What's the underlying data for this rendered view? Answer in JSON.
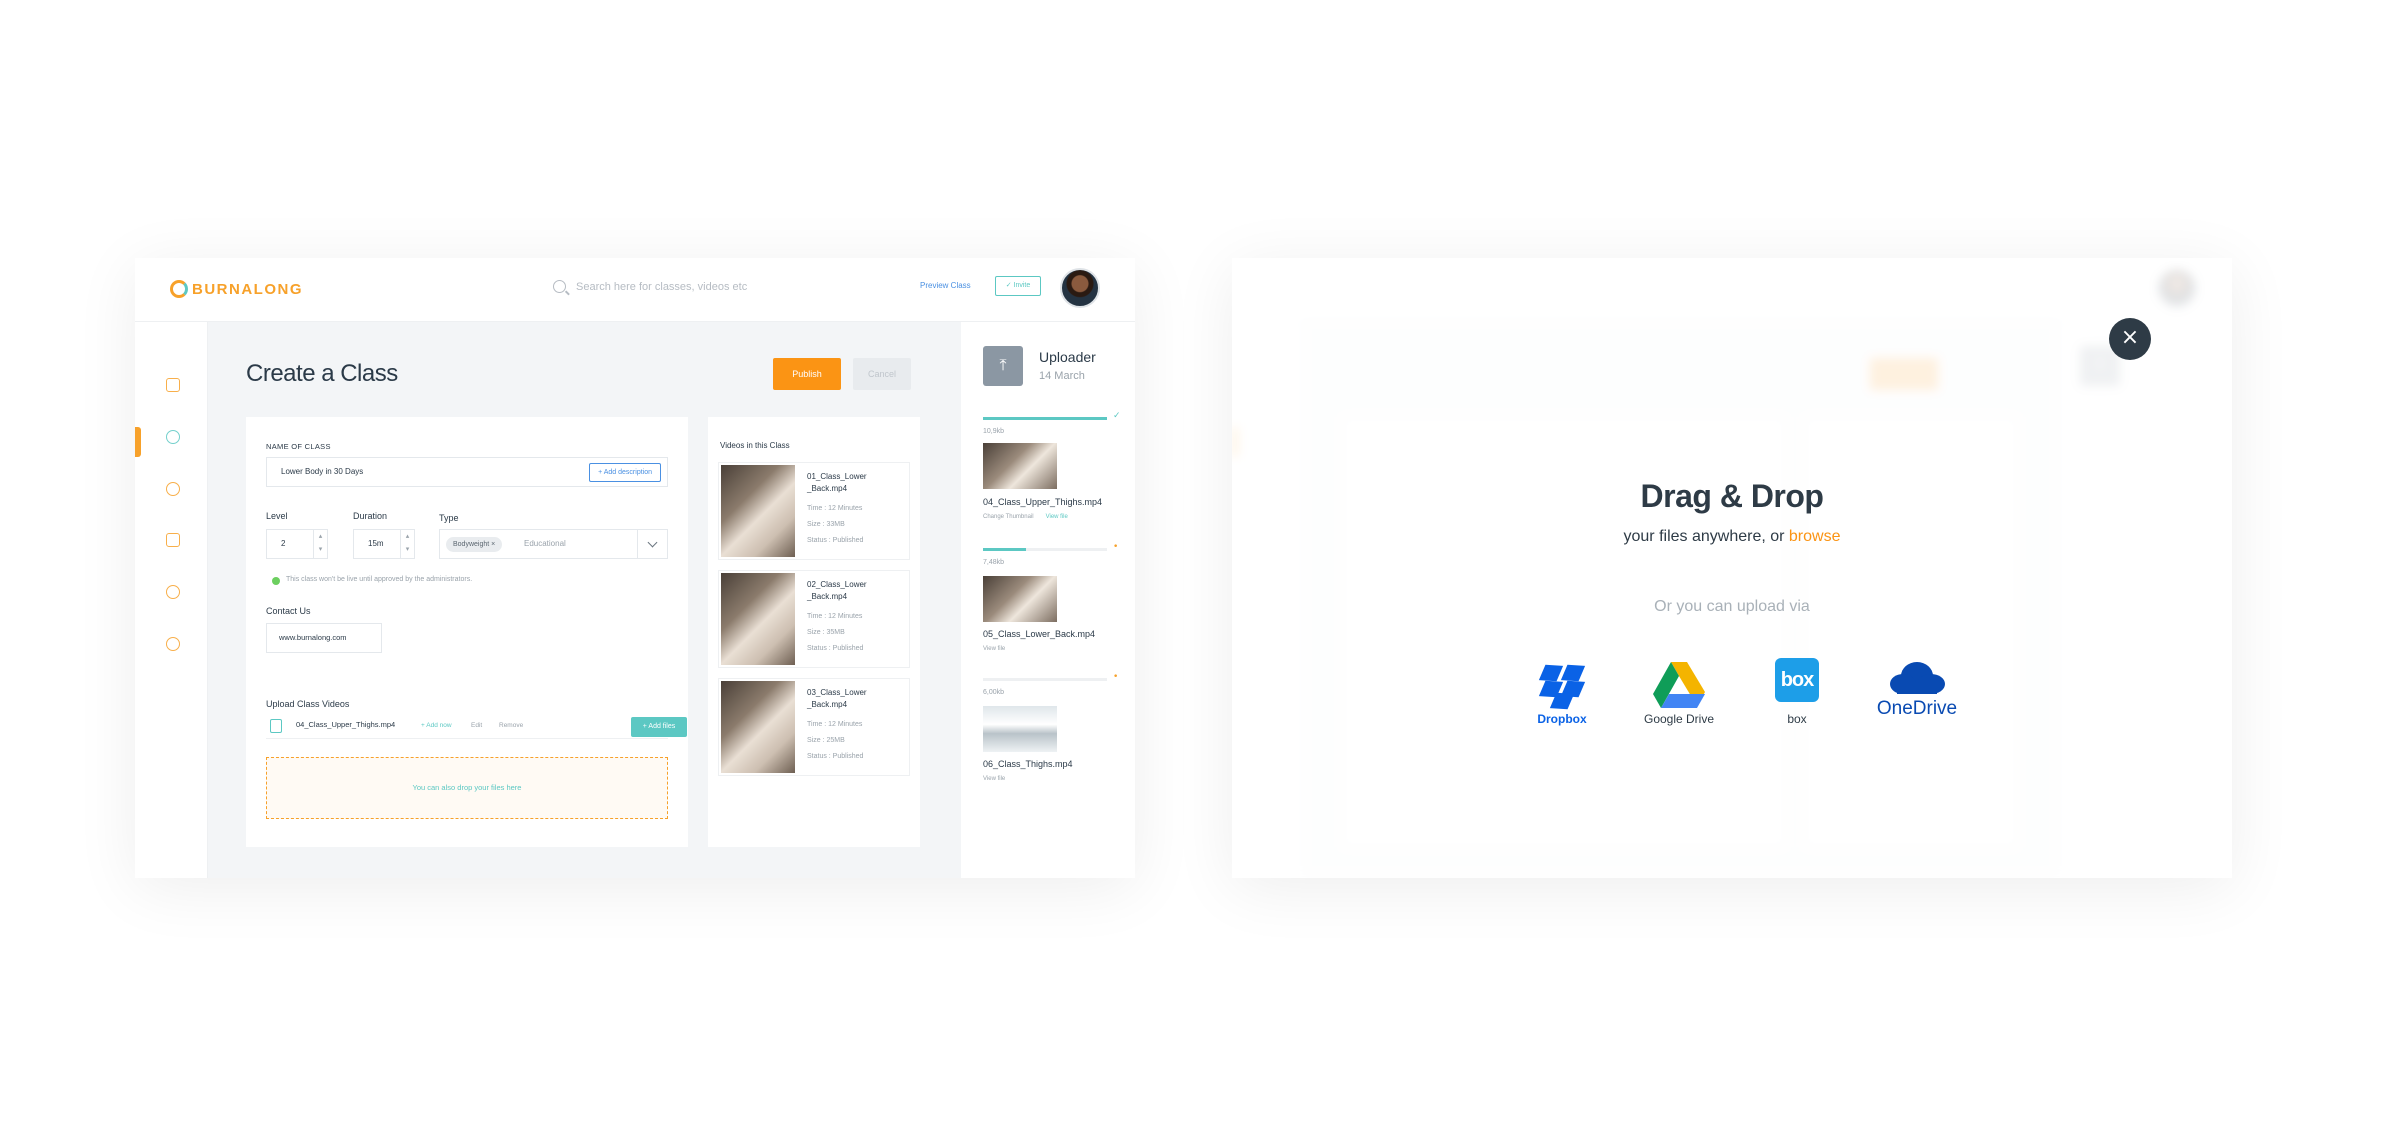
{
  "app": {
    "logo": "BURNALONG",
    "search_placeholder": "Search here for classes, videos etc",
    "preview_label": "Preview Class",
    "invite_label": "✓ Invite"
  },
  "sidebar": {
    "items": [
      "classes-icon",
      "instructor-icon",
      "user-icon",
      "document-icon",
      "support-icon",
      "settings-icon"
    ],
    "active_index": 1
  },
  "page": {
    "title": "Create a Class",
    "publish_label": "Publish",
    "cancel_label": "Cancel"
  },
  "form": {
    "name_label": "NAME OF CLASS",
    "name_value": "Lower Body in 30 Days",
    "add_description": "+ Add description",
    "level_label": "Level",
    "level_value": "2",
    "duration_label": "Duration",
    "duration_value": "15m",
    "type_label": "Type",
    "type_tag": "Bodyweight ×",
    "type_rest": "Educational",
    "note": "This class won't be live until approved by the administrators.",
    "contact_label": "Contact Us",
    "contact_value": "www.burnalong.com",
    "upload_label": "Upload Class Videos",
    "upload_file": "04_Class_Upper_Thighs.mp4",
    "upload_actions": [
      "+ Add now",
      "Edit",
      "Remove"
    ],
    "add_files": "+ Add files",
    "dropzone": "You can also drop your files here"
  },
  "videos": {
    "title": "Videos in this Class",
    "items": [
      {
        "name": "01_Class_Lower _Back.mp4",
        "time": "Time : 12 Minutes",
        "size": "Size : 33MB",
        "status": "Status : Published"
      },
      {
        "name": "02_Class_Lower _Back.mp4",
        "time": "Time : 12 Minutes",
        "size": "Size : 35MB",
        "status": "Status : Published"
      },
      {
        "name": "03_Class_Lower _Back.mp4",
        "time": "Time : 12 Minutes",
        "size": "Size : 25MB",
        "status": "Status : Published"
      }
    ]
  },
  "uploader": {
    "title": "Uploader",
    "date": "14 March",
    "items": [
      {
        "size": "10,9kb",
        "name": "04_Class_Upper_Thighs.mp4",
        "links": [
          "Change Thumbnail",
          "View file"
        ],
        "progress": 1.0,
        "mark": "✓"
      },
      {
        "size": "7,48kb",
        "name": "05_Class_Lower_Back.mp4",
        "links": [
          "View file"
        ],
        "progress": 0.35,
        "mark": "•"
      },
      {
        "size": "6,00kb",
        "name": "06_Class_Thighs.mp4",
        "links": [
          "View file"
        ],
        "progress": 0.0,
        "mark": "•"
      }
    ]
  },
  "modal": {
    "close": "×",
    "title": "Drag & Drop",
    "subtitle": "your files anywhere, or ",
    "browse": "browse",
    "or_label": "Or you can upload via",
    "providers": [
      {
        "name": "Dropbox",
        "icon": "dropbox-icon",
        "color": "#0a62e6"
      },
      {
        "name": "Google Drive",
        "icon": "google-drive-icon",
        "color": "#2e3b46"
      },
      {
        "name": "box",
        "icon": "box-icon",
        "color": "#1d9ee8"
      },
      {
        "name": "OneDrive",
        "icon": "onedrive-icon",
        "color": "#094ab2"
      }
    ]
  },
  "colors": {
    "accent_orange": "#fb9414",
    "accent_teal": "#5cc8c3",
    "text_dark": "#2b3a48"
  }
}
